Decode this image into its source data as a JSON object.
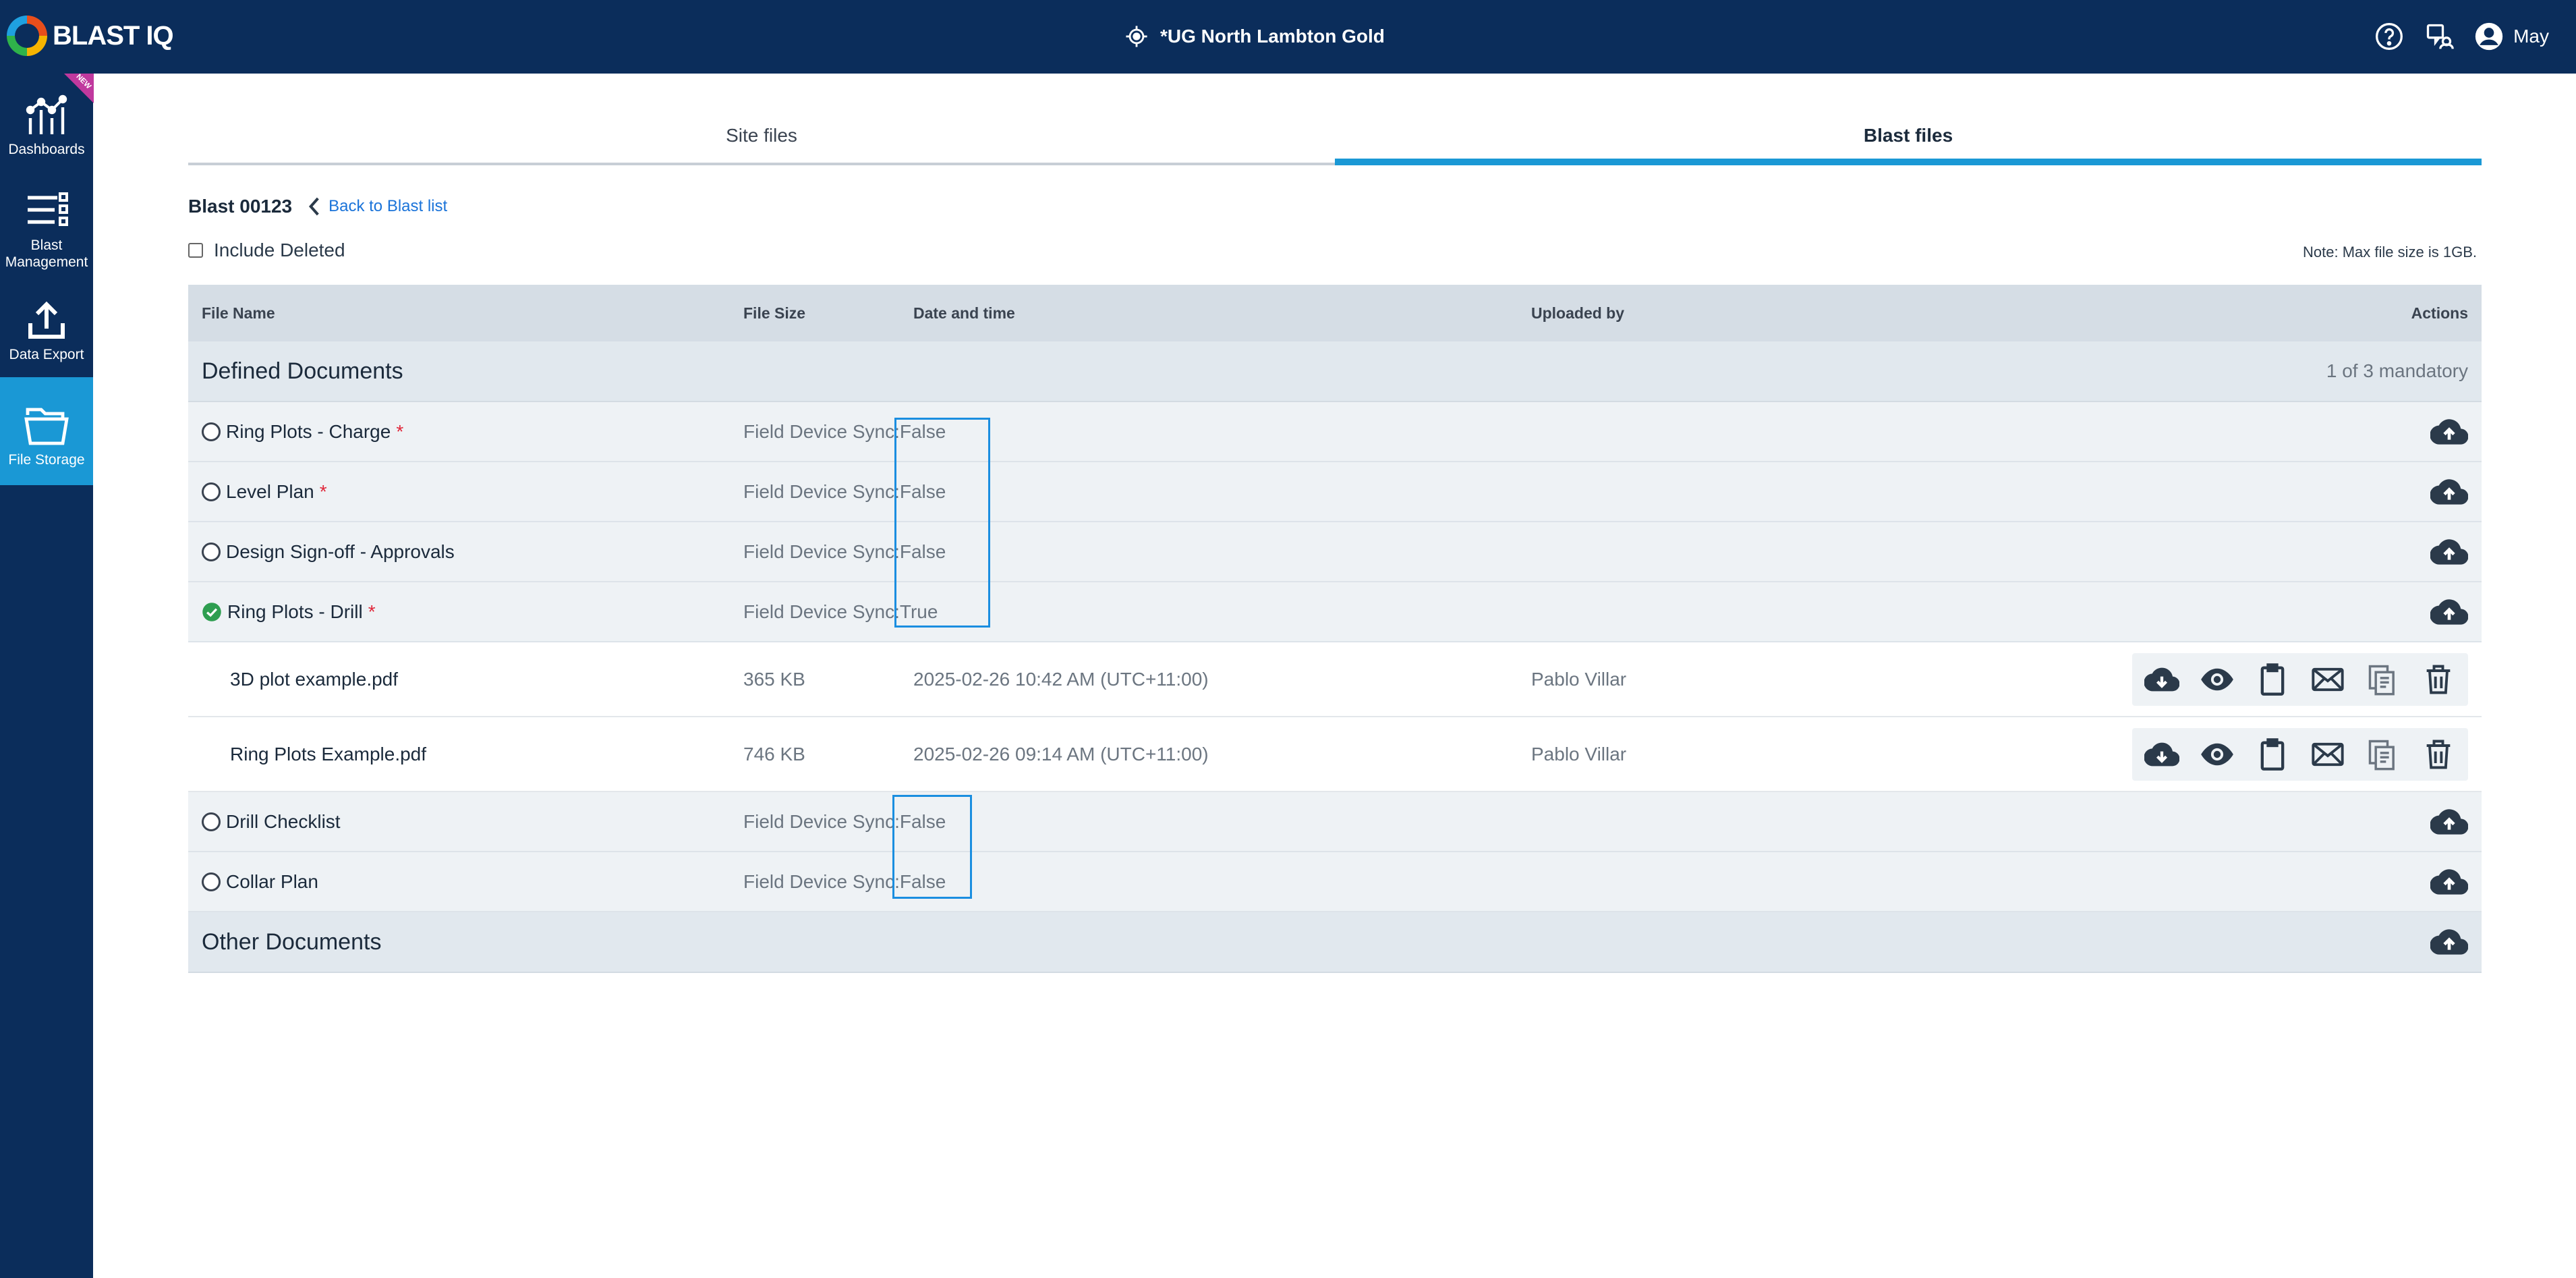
{
  "app": {
    "logo_text": "BLAST IQ",
    "site_name": "*UG North Lambton Gold",
    "user_name": "May"
  },
  "sidebar": {
    "new_badge": "NEW",
    "items": [
      {
        "label_line1": "Dashboards",
        "label_line2": ""
      },
      {
        "label_line1": "Blast",
        "label_line2": "Management"
      },
      {
        "label_line1": "Data Export",
        "label_line2": ""
      },
      {
        "label_line1": "File Storage",
        "label_line2": ""
      }
    ]
  },
  "tabs": [
    {
      "label": "Site files"
    },
    {
      "label": "Blast files"
    }
  ],
  "blast": {
    "title": "Blast 00123",
    "back_label": "Back to Blast list"
  },
  "include_deleted_label": "Include Deleted",
  "note": "Note: Max file size is 1GB.",
  "table": {
    "headers": {
      "file_name": "File Name",
      "file_size": "File Size",
      "date_time": "Date and time",
      "uploaded_by": "Uploaded by",
      "actions": "Actions"
    },
    "defined_section": {
      "title": "Defined Documents",
      "count": "1 of 3 mandatory"
    },
    "docs": [
      {
        "name": "Ring Plots - Charge",
        "required": "*",
        "sync_label": "Field Device Sync:",
        "sync_value": "False",
        "status": "empty"
      },
      {
        "name": "Level Plan",
        "required": "*",
        "sync_label": "Field Device Sync:",
        "sync_value": "False",
        "status": "empty"
      },
      {
        "name": "Design Sign-off - Approvals",
        "required": "",
        "sync_label": "Field Device Sync:",
        "sync_value": "False",
        "status": "empty"
      },
      {
        "name": "Ring Plots - Drill",
        "required": "*",
        "sync_label": "Field Device Sync:",
        "sync_value": "True",
        "status": "complete"
      }
    ],
    "files": [
      {
        "name": "3D plot example.pdf",
        "size": "365 KB",
        "date": "2025-02-26 10:42 AM (UTC+11:00)",
        "uploaded_by": "Pablo Villar"
      },
      {
        "name": "Ring Plots Example.pdf",
        "size": "746 KB",
        "date": "2025-02-26 09:14 AM (UTC+11:00)",
        "uploaded_by": "Pablo Villar"
      }
    ],
    "docs_after": [
      {
        "name": "Drill Checklist",
        "sync_label": "Field Device Sync:",
        "sync_value": "False",
        "status": "empty"
      },
      {
        "name": "Collar Plan",
        "sync_label": "Field Device Sync:",
        "sync_value": "False",
        "status": "empty"
      }
    ],
    "other_section": {
      "title": "Other Documents"
    }
  },
  "icons": {
    "file_actions": [
      "download-icon",
      "view-icon",
      "clipboard-icon",
      "email-icon",
      "copy-icon",
      "delete-icon"
    ],
    "row_action": "cloud-upload-icon"
  },
  "colors": {
    "nav_bg": "#0b2d5b",
    "accent": "#1a98d5",
    "required": "#e0273a",
    "success": "#2e9e50"
  }
}
